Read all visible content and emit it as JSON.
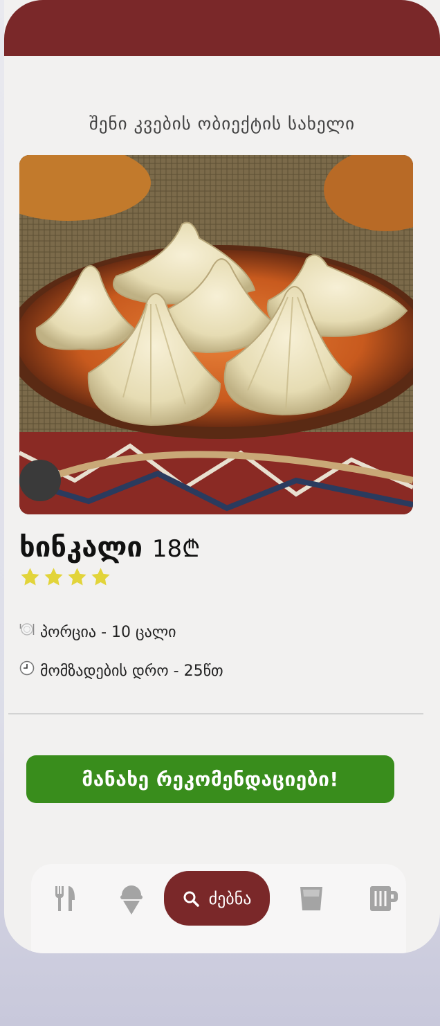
{
  "header": {
    "venue_name": "შენი კვების ობიექტის სახელი"
  },
  "dish": {
    "name": "ხინკალი",
    "price": "18₾",
    "rating": 4,
    "rating_max": 4,
    "portion": "პორცია - 10 ცალი",
    "prep_time": "მომზადების დრო -  25წთ"
  },
  "cta": {
    "label": "მანახე რეკომენდაციები!"
  },
  "nav": {
    "items": [
      {
        "icon": "fork-knife-icon"
      },
      {
        "icon": "ice-cream-icon"
      },
      {
        "icon": "search-icon",
        "label": "ძებნა",
        "active": true
      },
      {
        "icon": "glass-icon"
      },
      {
        "icon": "beer-mug-icon"
      }
    ]
  },
  "colors": {
    "brand": "#7a2829",
    "cta": "#398d1c",
    "star": "#e2d43a",
    "nav_icon": "#a4a4a4"
  }
}
